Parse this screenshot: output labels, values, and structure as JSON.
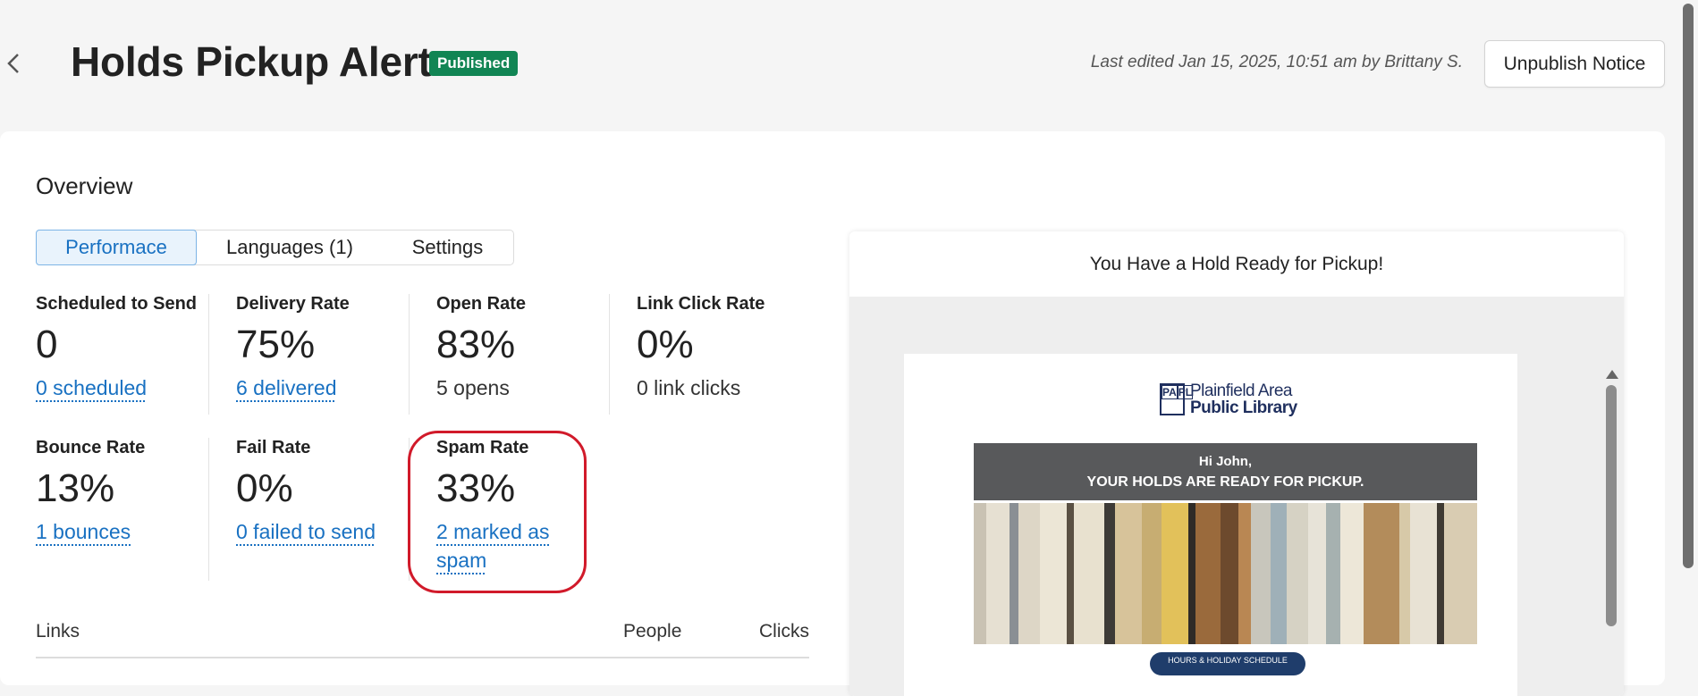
{
  "header": {
    "title": "Holds Pickup Alert",
    "status_badge": "Published",
    "last_edited": "Last edited Jan 15, 2025, 10:51 am by Brittany  S.",
    "unpublish_label": "Unpublish Notice"
  },
  "overview": {
    "title": "Overview",
    "tabs": [
      {
        "label": "Performace",
        "active": true
      },
      {
        "label": "Languages (1)",
        "active": false
      },
      {
        "label": "Settings",
        "active": false
      }
    ],
    "metrics": [
      {
        "label": "Scheduled to Send",
        "value": "0",
        "sub": "0 scheduled"
      },
      {
        "label": "Delivery Rate",
        "value": "75%",
        "sub": "6 delivered"
      },
      {
        "label": "Open Rate",
        "value": "83%",
        "sub": "5 opens"
      },
      {
        "label": "Link Click Rate",
        "value": "0%",
        "sub": "0 link clicks"
      },
      {
        "label": "Bounce Rate",
        "value": "13%",
        "sub": "1 bounces"
      },
      {
        "label": "Fail Rate",
        "value": "0%",
        "sub": "0 failed to send"
      },
      {
        "label": "Spam Rate",
        "value": "33%",
        "sub": "2 marked as spam"
      }
    ],
    "links_table": {
      "col_links": "Links",
      "col_people": "People",
      "col_clicks": "Clicks"
    }
  },
  "preview": {
    "subject": "You Have a Hold Ready for Pickup!",
    "logo_mark": [
      "PA",
      "PL"
    ],
    "logo_line1": "Plainfield Area",
    "logo_line2": "Public Library",
    "banner_line1": "Hi John,",
    "banner_line2": "YOUR HOLDS ARE READY FOR PICKUP.",
    "pill_text": "HOURS & HOLIDAY SCHEDULE"
  },
  "colors": {
    "accent": "#1971c2",
    "published": "#118554",
    "highlight": "#d11a2a"
  }
}
